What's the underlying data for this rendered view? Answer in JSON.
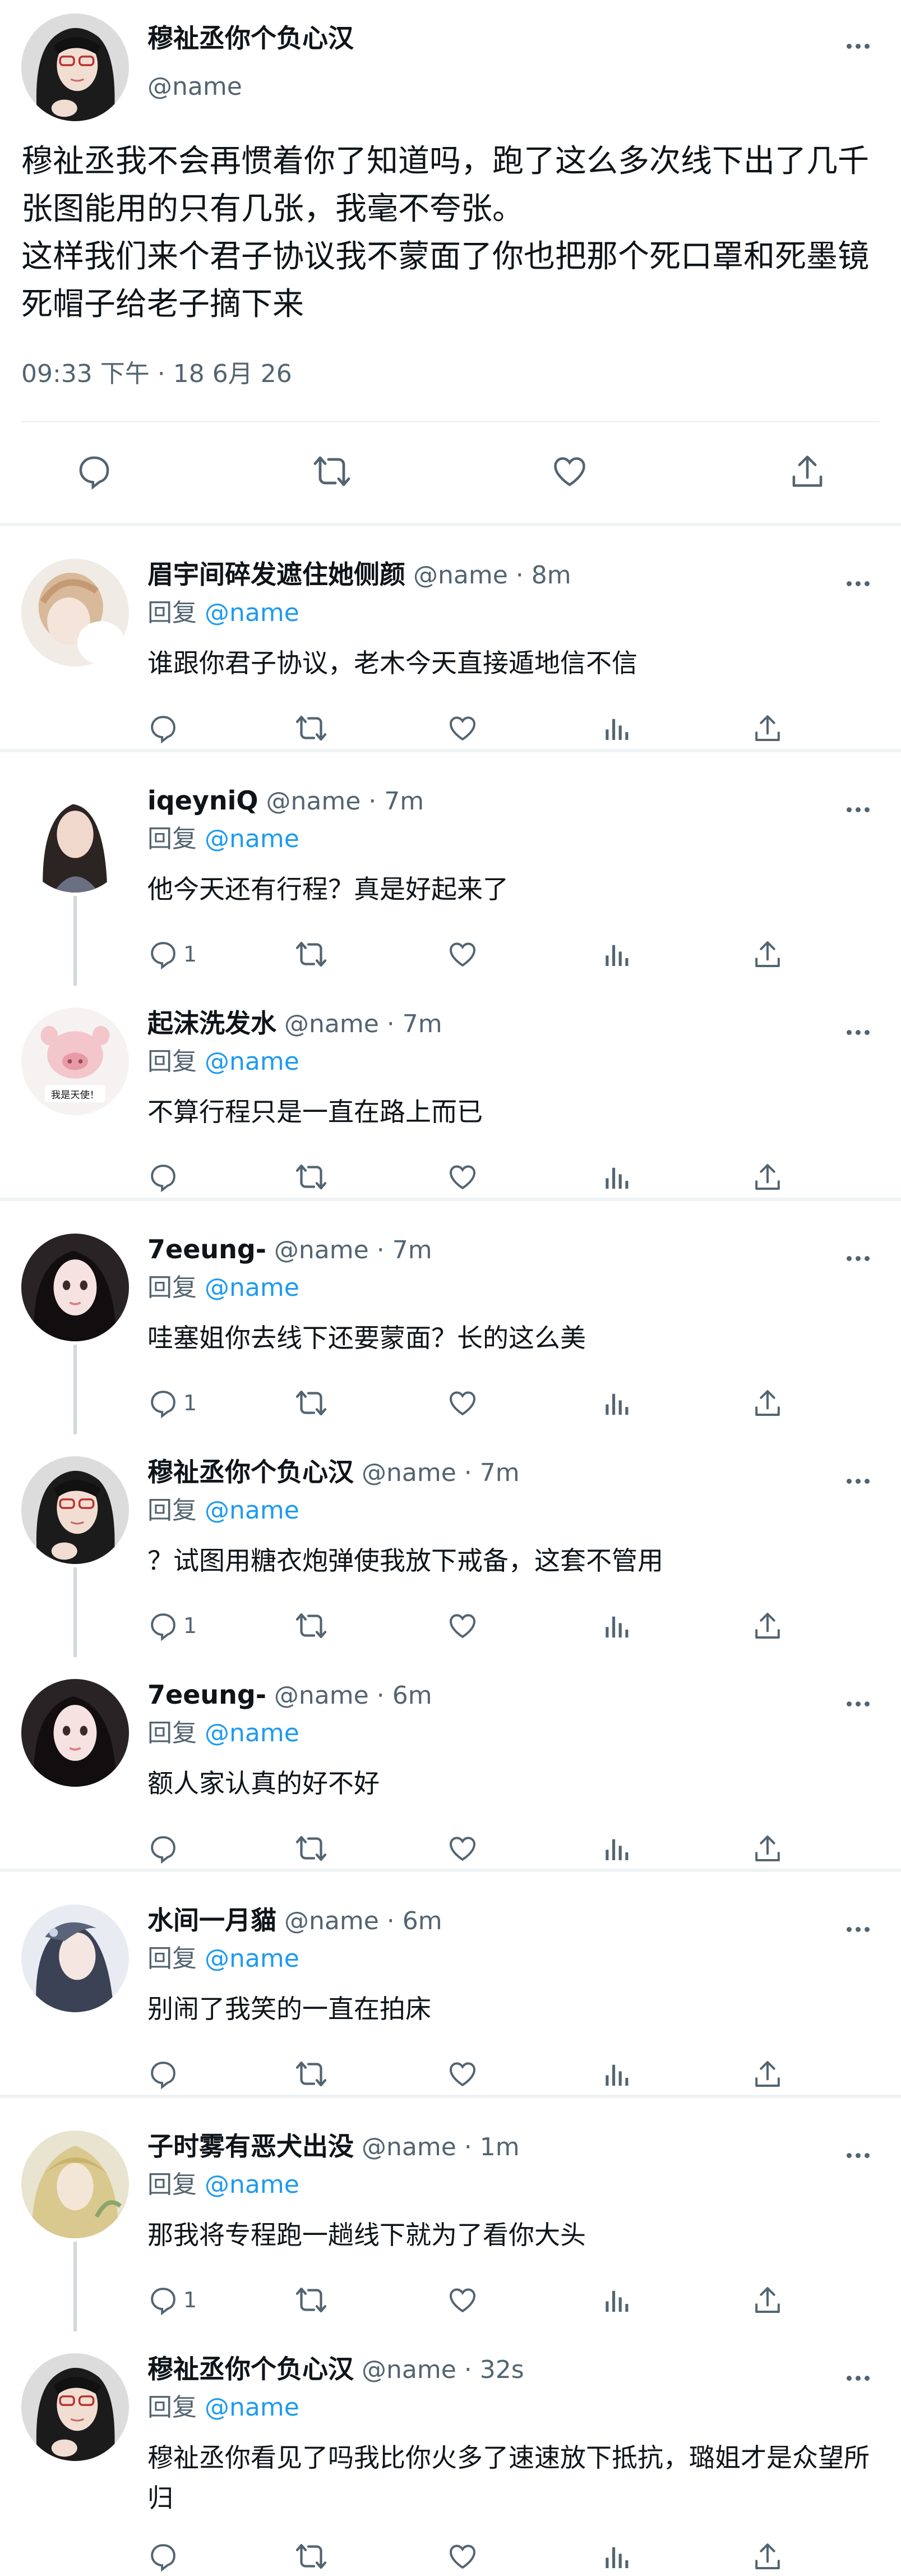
{
  "main_tweet": {
    "author_name": "穆祉丞你个负心汉",
    "handle": "@name",
    "text": "穆祉丞我不会再惯着你了知道吗，跑了这么多次线下出了几千张图能用的只有几张，我毫不夸张。\n这样我们来个君子协议我不蒙面了你也把那个死口罩和死墨镜死帽子给老子摘下来",
    "time": "09:33 下午 · 18 6月 26",
    "icons": [
      "reply-icon",
      "retweet-icon",
      "like-icon",
      "share-icon"
    ]
  },
  "reply_prefix": "回复",
  "threads": [
    {
      "tweets": [
        {
          "name": "眉宇间碎发遮住她侧颜",
          "handle": "@name",
          "time": "8m",
          "mention": "@name",
          "text": "谁跟你君子协议，老木今天直接遁地信不信",
          "reply_count": ""
        }
      ]
    },
    {
      "tweets": [
        {
          "name": "iqeyniQ",
          "handle": "@name",
          "time": "7m",
          "mention": "@name",
          "text": "他今天还有行程？真是好起来了",
          "reply_count": "1"
        },
        {
          "name": "起沫洗发水",
          "handle": "@name",
          "time": "7m",
          "mention": "@name",
          "text": "不算行程只是一直在路上而已",
          "reply_count": ""
        }
      ]
    },
    {
      "tweets": [
        {
          "name": "7eeung-",
          "handle": "@name",
          "time": "7m",
          "mention": "@name",
          "text": "哇塞姐你去线下还要蒙面？长的这么美",
          "reply_count": "1"
        },
        {
          "name": "穆祉丞你个负心汉",
          "handle": "@name",
          "time": "7m",
          "mention": "@name",
          "text": "？试图用糖衣炮弹使我放下戒备，这套不管用",
          "reply_count": "1"
        },
        {
          "name": "7eeung-",
          "handle": "@name",
          "time": "6m",
          "mention": "@name",
          "text": "额人家认真的好不好",
          "reply_count": ""
        }
      ]
    },
    {
      "tweets": [
        {
          "name": "水间一月貓",
          "handle": "@name",
          "time": "6m",
          "mention": "@name",
          "text": "别闹了我笑的一直在拍床",
          "reply_count": ""
        }
      ]
    },
    {
      "tweets": [
        {
          "name": "子时雾有恶犬出没",
          "handle": "@name",
          "time": "1m",
          "mention": "@name",
          "text": "那我将专程跑一趟线下就为了看你大头",
          "reply_count": "1"
        },
        {
          "name": "穆祉丞你个负心汉",
          "handle": "@name",
          "time": "32s",
          "mention": "@name",
          "text": "穆祉丞你看见了吗我比你火多了速速放下抵抗，璐姐才是众望所归",
          "reply_count": ""
        }
      ]
    }
  ],
  "avatar_sticker_text": "我是天使！",
  "colors": {
    "text": "#0f1419",
    "secondary": "#536471",
    "link": "#1d9bf0",
    "divider": "#eff3f4",
    "thread_line": "#cfd9de"
  }
}
